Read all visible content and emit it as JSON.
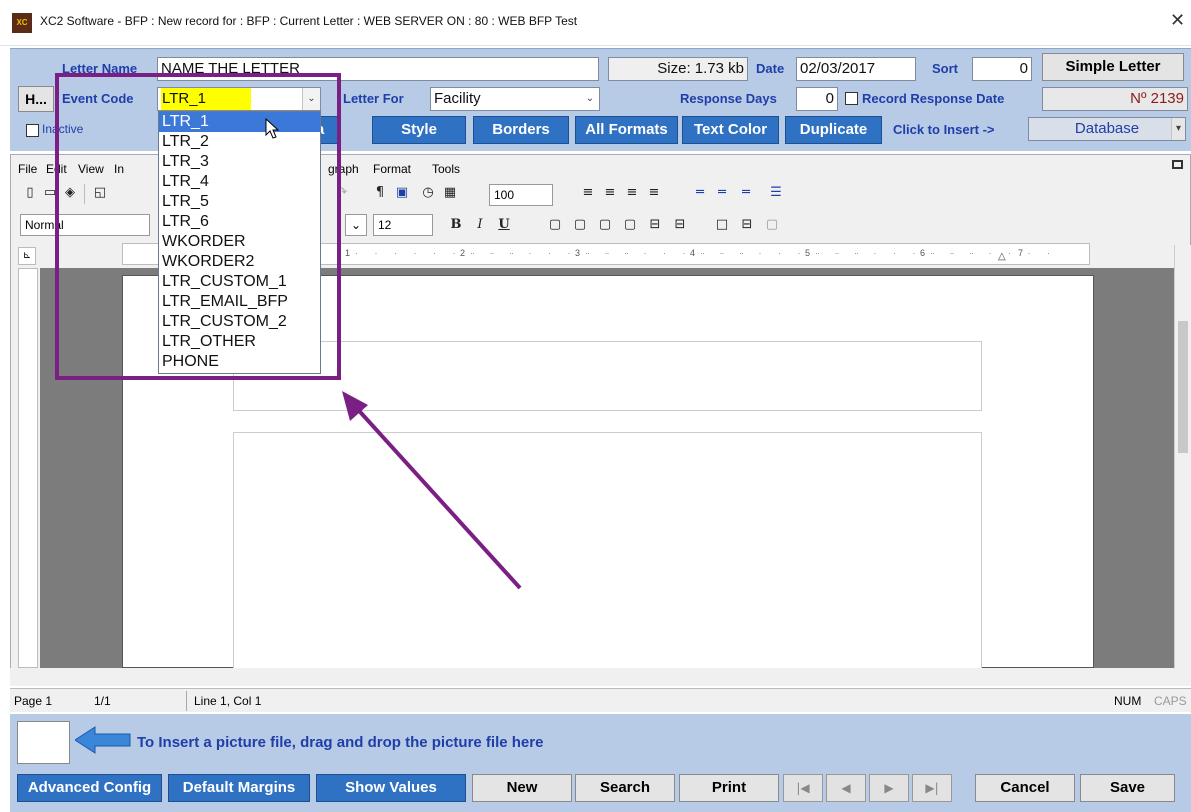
{
  "window": {
    "title": "XC2 Software - BFP : New record for : BFP : Current Letter : WEB SERVER ON : 80 : WEB BFP Test",
    "app_icon_text": "XC",
    "close_glyph": "✕"
  },
  "header": {
    "letter_name_label": "Letter Name",
    "letter_name_value": "NAME THE LETTER",
    "size_text": "Size: 1.73 kb",
    "date_label": "Date",
    "date_value": "02/03/2017",
    "sort_label": "Sort",
    "sort_value": "0",
    "simple_letter_button": "Simple Letter",
    "h_button": "H...",
    "event_code_label": "Event Code",
    "event_code_value": "LTR_1",
    "letter_for_label": "Letter For",
    "letter_for_value": "Facility",
    "response_days_label": "Response Days",
    "response_days_value": "0",
    "record_response_label": "Record Response Date",
    "record_number": "Nº 2139",
    "inactive_label": "Inactive",
    "partial_button": "a",
    "style_button": "Style",
    "borders_button": "Borders",
    "all_formats_button": "All Formats",
    "text_color_button": "Text Color",
    "duplicate_button": "Duplicate",
    "click_to_insert_label": "Click to Insert ->",
    "insert_source_value": "Database"
  },
  "editor": {
    "menu": [
      "File",
      "Edit",
      "View",
      "In",
      "graph",
      "Format",
      "Tools"
    ],
    "style_value": "Normal",
    "font_size_value": "12",
    "zoom_value": "100",
    "bold_glyph": "B",
    "italic_glyph": "I",
    "underline_glyph": "U",
    "pilcrow_glyph": "¶",
    "ruler_numbers": [
      "1",
      "2",
      "3",
      "4",
      "5",
      "6",
      "7"
    ]
  },
  "statusbar": {
    "page_label": "Page 1",
    "page_count": "1/1",
    "line_col": "Line 1, Col 1",
    "num": "NUM",
    "caps": "CAPS"
  },
  "drop": {
    "instruction": "To Insert a picture file, drag and drop the picture file here"
  },
  "bottom": {
    "advanced_config": "Advanced Config",
    "default_margins": "Default Margins",
    "show_values": "Show Values",
    "new": "New",
    "search": "Search",
    "print": "Print",
    "first": "|◀",
    "prev": "◀",
    "next": "▶",
    "last": "▶|",
    "cancel": "Cancel",
    "save": "Save"
  },
  "dropdown": {
    "items": [
      "LTR_1",
      "LTR_2",
      "LTR_3",
      "LTR_4",
      "LTR_5",
      "LTR_6",
      "WKORDER",
      "WKORDER2",
      "LTR_CUSTOM_1",
      "LTR_EMAIL_BFP",
      "LTR_CUSTOM_2",
      "LTR_OTHER",
      "PHONE"
    ],
    "selected_index": 0
  },
  "colors": {
    "panel_blue": "#b8cbe6",
    "label_blue": "#1f3ea8",
    "button_blue": "#2f71c2",
    "annotation_purple": "#7a1f84",
    "event_code_highlight": "#ffff00"
  }
}
